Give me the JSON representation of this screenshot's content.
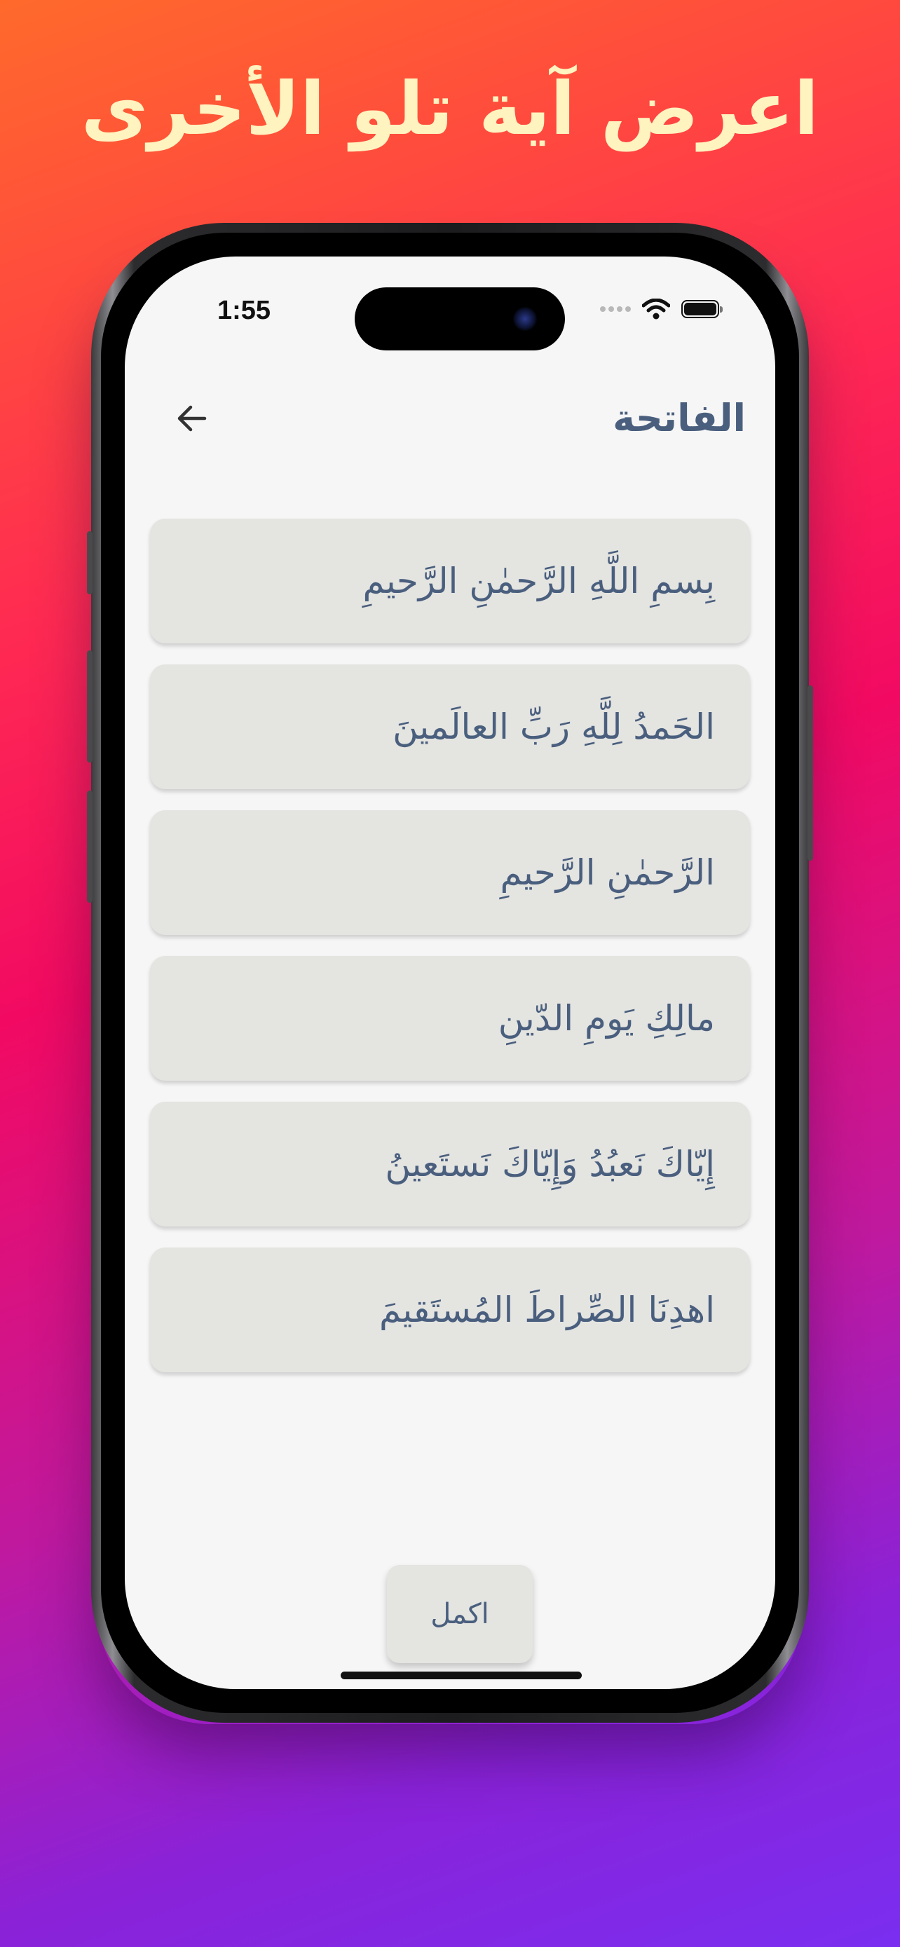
{
  "headline": "اعرض آية تلو الأخرى",
  "status_bar": {
    "time": "1:55"
  },
  "nav": {
    "back_icon": "arrow-left-icon",
    "title": "الفاتحة"
  },
  "verses": [
    "بِسمِ اللَّهِ الرَّحمٰنِ الرَّحيمِ",
    "الحَمدُ لِلَّهِ رَبِّ العالَمينَ",
    "الرَّحمٰنِ الرَّحيمِ",
    "مالِكِ يَومِ الدّينِ",
    "إِيّاكَ نَعبُدُ وَإِيّاكَ نَستَعينُ",
    "اهدِنَا الصِّراطَ المُستَقيمَ"
  ],
  "continue_button": "اكمل",
  "colors": {
    "headline": "#fff3c0",
    "text": "#4a5f7e",
    "card": "#e4e4e1",
    "screen": "#f6f6f6"
  }
}
